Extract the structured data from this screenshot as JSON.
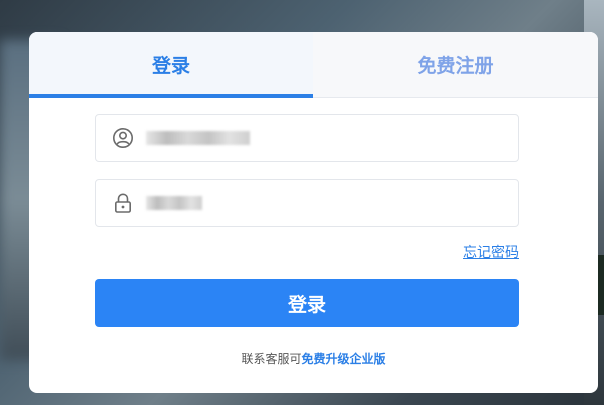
{
  "tabs": {
    "login": "登录",
    "register": "免费注册"
  },
  "form": {
    "username_value": "",
    "password_value": "",
    "forgot_password": "忘记密码",
    "submit": "登录"
  },
  "footer": {
    "contact_text": "联系客服可",
    "upgrade_link": "免费升级企业版"
  },
  "icons": {
    "username": "user-icon",
    "password": "lock-icon"
  },
  "colors": {
    "accent": "#2b7fe6",
    "button": "#2b84f5",
    "register_tab_text": "#7fa3e8"
  }
}
